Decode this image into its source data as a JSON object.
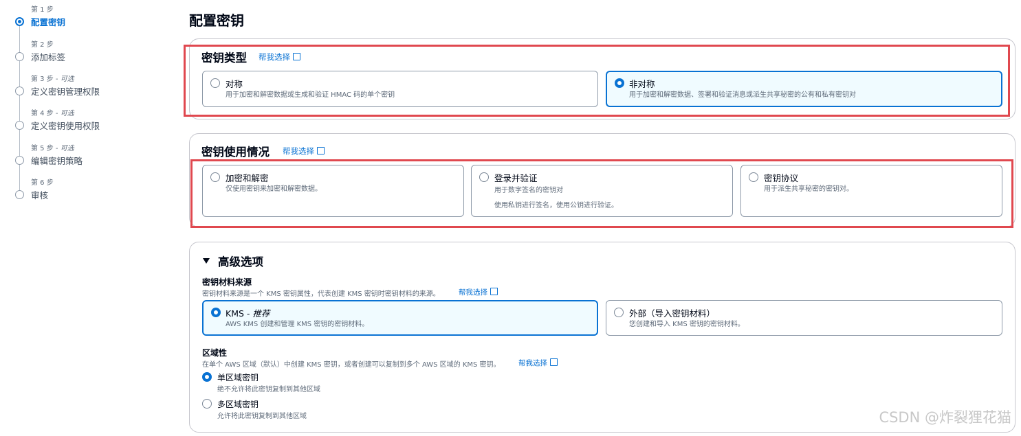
{
  "steps": [
    {
      "small": "第 1 步",
      "optional": "",
      "label": "配置密钥",
      "active": true
    },
    {
      "small": "第 2 步",
      "optional": "",
      "label": "添加标签",
      "active": false
    },
    {
      "small": "第 3 步 - ",
      "optional": "可选",
      "label": "定义密钥管理权限",
      "active": false
    },
    {
      "small": "第 4 步 - ",
      "optional": "可选",
      "label": "定义密钥使用权限",
      "active": false
    },
    {
      "small": "第 5 步 - ",
      "optional": "可选",
      "label": "编辑密钥策略",
      "active": false
    },
    {
      "small": "第 6 步",
      "optional": "",
      "label": "审核",
      "active": false
    }
  ],
  "page_title": "配置密钥",
  "key_type": {
    "heading": "密钥类型",
    "help": "帮我选择",
    "options": [
      {
        "title": "对称",
        "desc": "用于加密和解密数据或生成和验证 HMAC 码的单个密钥",
        "selected": false
      },
      {
        "title": "非对称",
        "desc": "用于加密和解密数据、签署和验证消息或派生共享秘密的公有和私有密钥对",
        "selected": true
      }
    ]
  },
  "key_usage": {
    "heading": "密钥使用情况",
    "help": "帮我选择",
    "options": [
      {
        "title": "加密和解密",
        "desc": "仅使用密钥来加密和解密数据。",
        "desc2": ""
      },
      {
        "title": "登录并验证",
        "desc": "用于数字签名的密钥对",
        "desc2": "使用私钥进行签名，使用公钥进行验证。"
      },
      {
        "title": "密钥协议",
        "desc": "用于派生共享秘密的密钥对。",
        "desc2": ""
      }
    ]
  },
  "advanced": {
    "heading": "高级选项",
    "material_origin": {
      "label": "密钥材料来源",
      "desc": "密钥材料来源是一个 KMS 密钥属性，代表创建 KMS 密钥时密钥材料的来源。",
      "help": "帮我选择",
      "options": [
        {
          "title": "KMS - ",
          "rec": "推荐",
          "desc": "AWS KMS 创建和管理 KMS 密钥的密钥材料。",
          "selected": true
        },
        {
          "title": "外部（导入密钥材料）",
          "rec": "",
          "desc": "您创建和导入 KMS 密钥的密钥材料。",
          "selected": false
        }
      ]
    },
    "regionality": {
      "label": "区域性",
      "desc": "在单个 AWS 区域（默认）中创建 KMS 密钥，或者创建可以复制到多个 AWS 区域的 KMS 密钥。",
      "help": "帮我选择",
      "options": [
        {
          "title": "单区域密钥",
          "desc": "绝不允许将此密钥复制到其他区域",
          "selected": true
        },
        {
          "title": "多区域密钥",
          "desc": "允许将此密钥复制到其他区域",
          "selected": false
        }
      ]
    }
  },
  "colors": {
    "accent": "#0972d3",
    "highlight": "#e0484f",
    "selected_bg": "#f0fbff"
  },
  "watermark": "CSDN @炸裂狸花猫"
}
